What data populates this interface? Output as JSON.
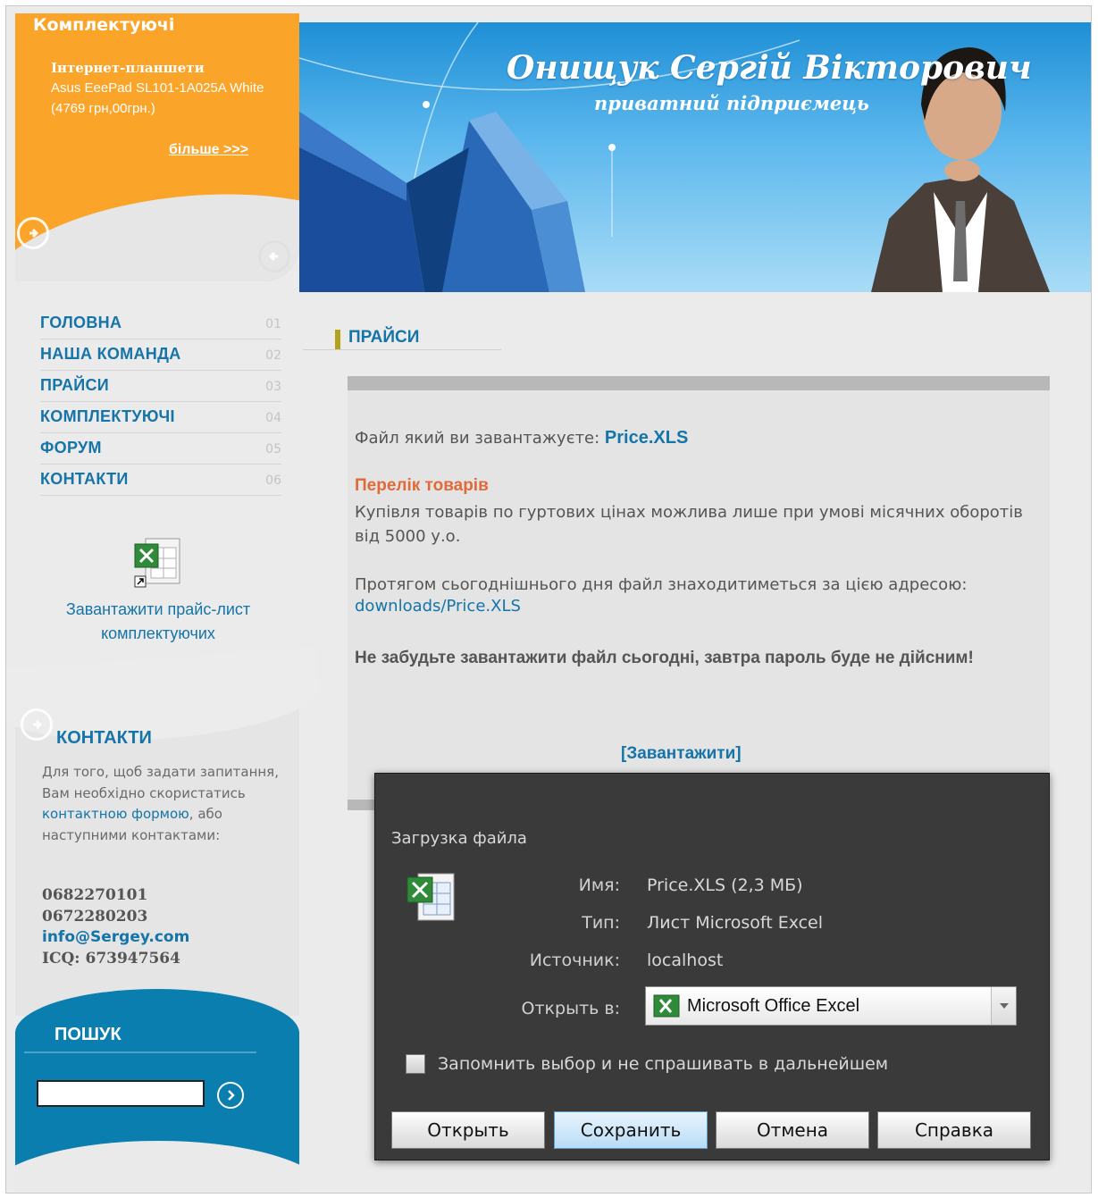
{
  "promo": {
    "heading": "Комплектуючі",
    "title": "Інтернет-планшети",
    "text": "Asus EeePad SL101-1A025A White (4769 грн,00грн.)",
    "more": "більше >>>"
  },
  "nav": {
    "items": [
      {
        "label": "ГОЛОВНА",
        "num": "01"
      },
      {
        "label": "НАША КОМАНДА",
        "num": "02"
      },
      {
        "label": "ПРАЙСИ",
        "num": "03"
      },
      {
        "label": "КОМПЛЕКТУЮЧІ",
        "num": "04"
      },
      {
        "label": "ФОРУМ",
        "num": "05"
      },
      {
        "label": "КОНТАКТИ",
        "num": "06"
      }
    ]
  },
  "price_download": {
    "line1": "Завантажити прайс-лист",
    "line2": "комплектуючих"
  },
  "contacts": {
    "title": "КОНТАКТИ",
    "text_before": "Для того, щоб задати запитання, Вам необхідно скористатись ",
    "link": "контактною формою",
    "text_after": ", або наступними контактами:",
    "phone1": "0682270101",
    "phone2": "0672280203",
    "email": "info@Sergey.com",
    "icq": "ICQ: 673947564"
  },
  "search": {
    "title": "ПОШУК",
    "value": ""
  },
  "banner": {
    "name": "Онищук Сергій Вікторович",
    "subtitle": "приватний підприємець"
  },
  "main": {
    "section_title": "ПРАЙСИ",
    "file_prefix": "Файл який ви завантажуєте: ",
    "file_name": "Price.XLS",
    "list_title": "Перелік товарів",
    "list_text": "Купівля товарів по гуртових цінах можлива лише при умові місячних оборотів від 5000 у.о.",
    "address_text": "Протягом сьогоднішнього дня файл знаходитиметься за цією адресою:",
    "address_link": "downloads/Price.XLS",
    "warning": "Не забудьте завантажити файл сьогодні, завтра пароль буде не дійсним!",
    "download": "[Завантажити]"
  },
  "dialog": {
    "title": "Загрузка файла",
    "name_label": "Имя:",
    "name_value": "Price.XLS (2,3 МБ)",
    "type_label": "Тип:",
    "type_value": "Лист Microsoft Excel",
    "source_label": "Источник:",
    "source_value": "localhost",
    "open_label": "Открыть в:",
    "open_value": "Microsoft Office Excel",
    "remember": "Запомнить выбор и не спрашивать в дальнейшем",
    "btn_open": "Открыть",
    "btn_save": "Сохранить",
    "btn_cancel": "Отмена",
    "btn_help": "Справка"
  },
  "colors": {
    "accent": "#1574a8",
    "promo": "#faa42a",
    "search": "#0a7eae",
    "dialog": "#3a3a3a"
  }
}
